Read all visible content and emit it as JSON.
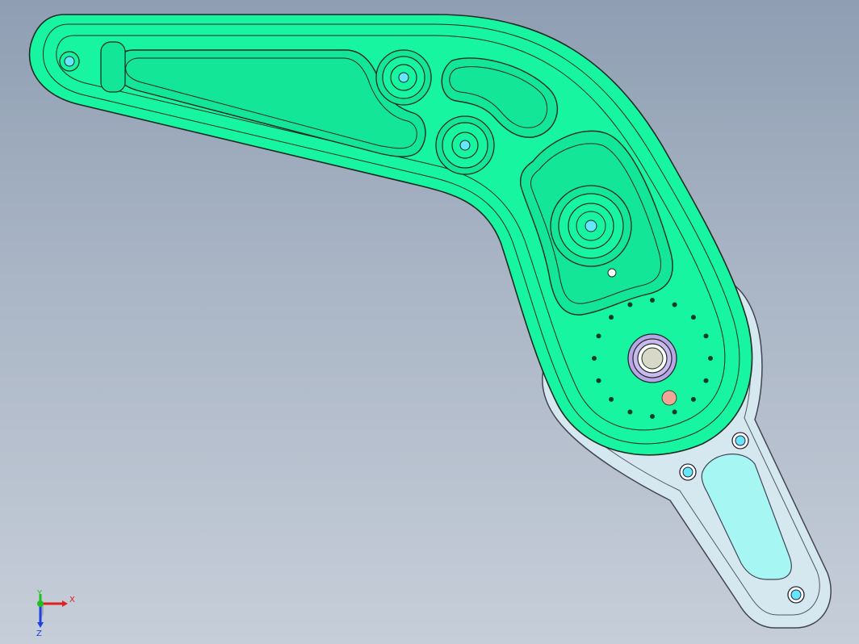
{
  "viewport": {
    "background_top": "#8f9eb3",
    "background_bottom": "#c6ced9"
  },
  "model": {
    "primary_part_color": "#17f5a0",
    "secondary_part_color": "#d8ecf3",
    "secondary_pocket_color": "#a4f7f4",
    "hole_color": "#67e6ff",
    "marker_color": "#f0a595",
    "bearing_color": "#b8a5e8"
  },
  "triad": {
    "x_label": "X",
    "y_label": "Y",
    "z_label": "Z",
    "x_color": "#e02020",
    "y_color": "#20c020",
    "z_color": "#2040e0"
  }
}
